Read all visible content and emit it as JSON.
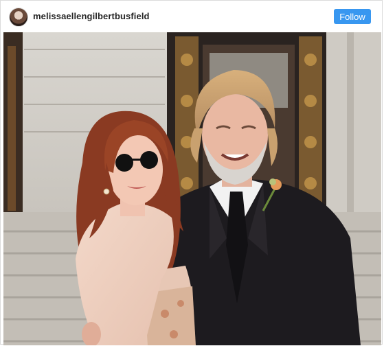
{
  "post": {
    "username": "melissaellengilbertbusfield",
    "follow_label": "Follow"
  },
  "icons": {
    "avatar": "profile-avatar"
  },
  "colors": {
    "follow_button": "#3897f0",
    "username_text": "#262626",
    "card_border": "#dbdbdb"
  }
}
